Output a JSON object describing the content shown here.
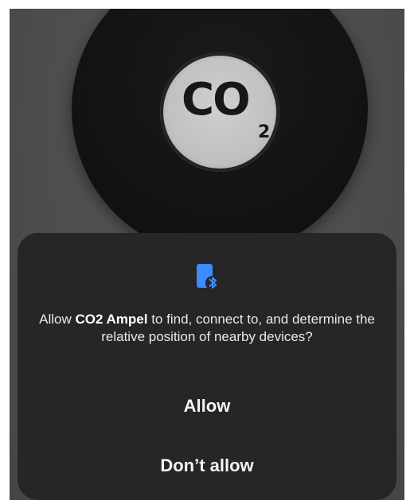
{
  "background": {
    "device_label": "CO",
    "device_label_subscript": "2"
  },
  "dialog": {
    "message_prefix": "Allow ",
    "app_name": "CO2 Ampel",
    "message_suffix": " to find, connect to, and determine the relative position of nearby devices?",
    "icon": "nearby-devices-bluetooth-icon",
    "allow_label": "Allow",
    "deny_label": "Don’t allow"
  },
  "colors": {
    "icon_accent": "#3d8bfd",
    "dialog_bg": "#262626"
  }
}
